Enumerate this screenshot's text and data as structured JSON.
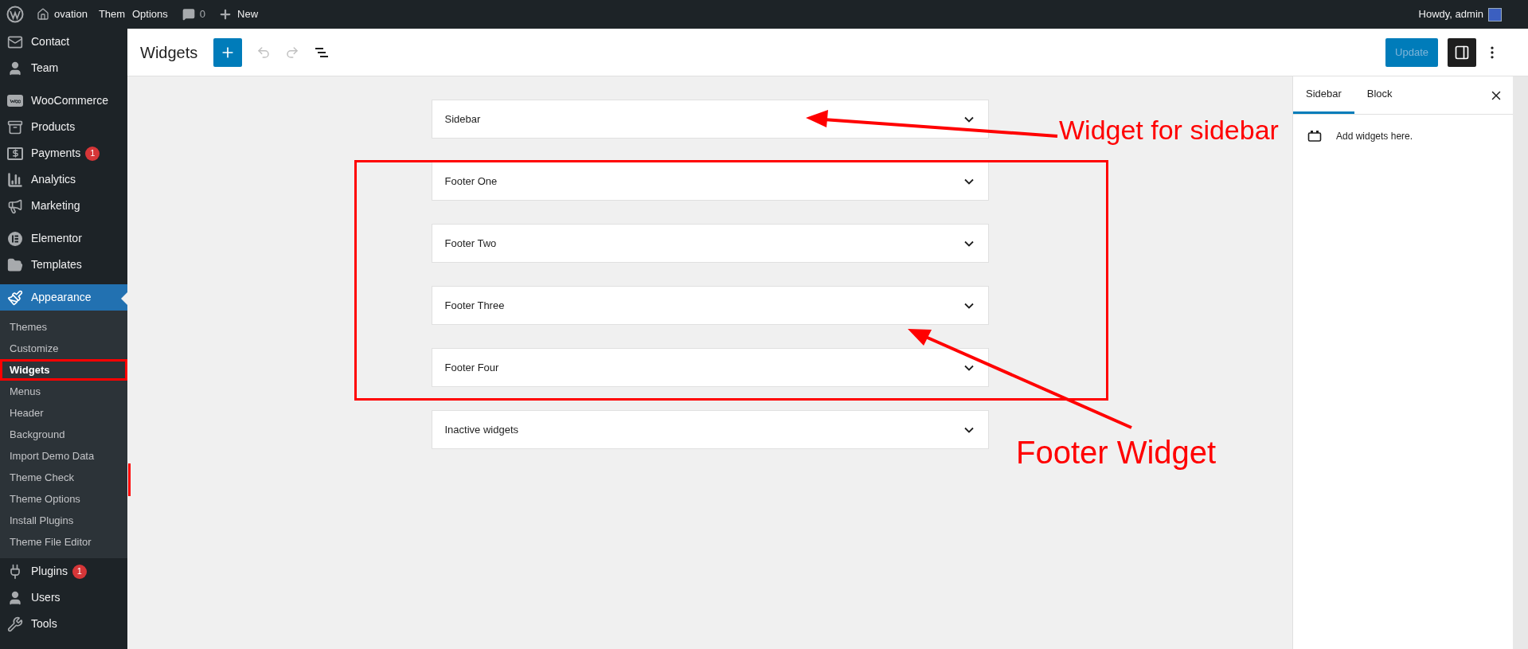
{
  "admin_bar": {
    "site": "ovation",
    "cut_item": "Them",
    "options": "Options",
    "comments": "0",
    "new": "New",
    "greeting": "Howdy, admin"
  },
  "sidebar": {
    "groups": [
      [
        {
          "label": "Contact",
          "selected": false
        },
        {
          "label": "Team",
          "selected": false
        }
      ],
      [
        {
          "label": "WooCommerce",
          "selected": false
        },
        {
          "label": "Products",
          "selected": false
        },
        {
          "label": "Payments",
          "badge": "1",
          "selected": false
        },
        {
          "label": "Analytics",
          "selected": false
        },
        {
          "label": "Marketing",
          "selected": false
        }
      ],
      [
        {
          "label": "Elementor",
          "selected": false
        },
        {
          "label": "Templates",
          "selected": false
        }
      ],
      [
        {
          "label": "Appearance",
          "selected": true,
          "children": [
            {
              "label": "Themes",
              "selected": false,
              "annotated": false
            },
            {
              "label": "Customize",
              "selected": false,
              "annotated": false
            },
            {
              "label": "Widgets",
              "selected": true,
              "annotated": true
            },
            {
              "label": "Menus",
              "selected": false,
              "annotated": false
            },
            {
              "label": "Header",
              "selected": false,
              "annotated": false
            },
            {
              "label": "Background",
              "selected": false,
              "annotated": false
            },
            {
              "label": "Import Demo Data",
              "selected": false,
              "annotated": false
            },
            {
              "label": "Theme Check",
              "selected": false,
              "annotated": false
            },
            {
              "label": "Theme Options",
              "selected": false,
              "annotated": false
            },
            {
              "label": "Install Plugins",
              "selected": false,
              "annotated": false
            },
            {
              "label": "Theme File Editor",
              "selected": false,
              "annotated": false
            }
          ]
        },
        {
          "label": "Plugins",
          "badge": "1",
          "selected": false
        },
        {
          "label": "Users",
          "selected": false
        },
        {
          "label": "Tools",
          "selected": false
        }
      ]
    ]
  },
  "header": {
    "title": "Widgets",
    "update": "Update",
    "settings_open": true
  },
  "widget_areas": [
    {
      "title": "Sidebar",
      "expanded": false
    },
    {
      "title": "Footer One",
      "expanded": false
    },
    {
      "title": "Footer Two",
      "expanded": false
    },
    {
      "title": "Footer Three",
      "expanded": false
    },
    {
      "title": "Footer Four",
      "expanded": false
    },
    {
      "title": "Inactive widgets",
      "expanded": false
    }
  ],
  "panel": {
    "tabs": [
      {
        "label": "Sidebar",
        "selected": true
      },
      {
        "label": "Block",
        "selected": false
      }
    ],
    "hint": "Add widgets here."
  },
  "annotations": [
    {
      "text": "Widget for sidebar",
      "kind": "label-top"
    },
    {
      "text": "Footer Widget",
      "kind": "label-bottom"
    }
  ]
}
